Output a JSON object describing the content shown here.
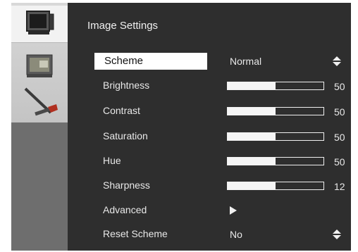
{
  "title": "Image Settings",
  "menu": {
    "scheme": {
      "label": "Scheme",
      "value": "Normal"
    },
    "brightness": {
      "label": "Brightness",
      "value": "50",
      "level": 0.5
    },
    "contrast": {
      "label": "Contrast",
      "value": "50",
      "level": 0.5
    },
    "saturation": {
      "label": "Saturation",
      "value": "50",
      "level": 0.5
    },
    "hue": {
      "label": "Hue",
      "value": "50",
      "level": 0.5
    },
    "sharpness": {
      "label": "Sharpness",
      "value": "12",
      "level": 0.5
    },
    "advanced": {
      "label": "Advanced"
    },
    "reset": {
      "label": "Reset Scheme",
      "value": "No"
    }
  },
  "sidebar": {
    "tabs": [
      "monitor-icon",
      "picture-icon",
      "tools-icon"
    ]
  },
  "colors": {
    "background": "#2e2e2e",
    "sidebar": "#6e6e6e",
    "highlight": "#ffffff"
  }
}
